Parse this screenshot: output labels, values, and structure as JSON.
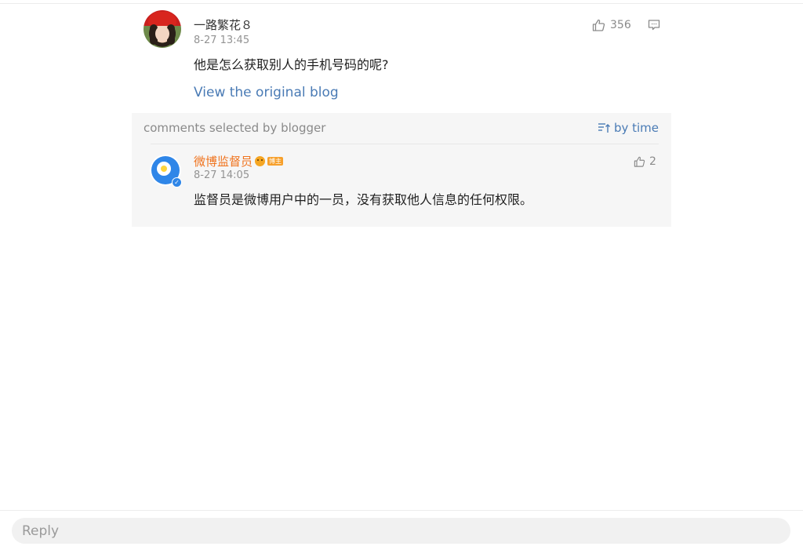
{
  "main_comment": {
    "username": "一路繁花８",
    "timestamp": "8-27 13:45",
    "text": "他是怎么获取别人的手机号码的呢?",
    "like_count": "356",
    "view_original_label": "View the original blog"
  },
  "selected_comments": {
    "title": "comments selected by blogger",
    "sort_label": "by time",
    "items": [
      {
        "username": "微博监督员",
        "tag": "博主",
        "timestamp": "8-27 14:05",
        "text": "监督员是微博用户中的一员，没有获取他人信息的任何权限。",
        "like_count": "2"
      }
    ]
  },
  "reply_bar": {
    "placeholder": "Reply"
  },
  "colors": {
    "link_blue": "#4a7bb5",
    "orange_name": "#f0731d",
    "panel_bg": "#f6f6f6",
    "muted_text": "#939393"
  }
}
